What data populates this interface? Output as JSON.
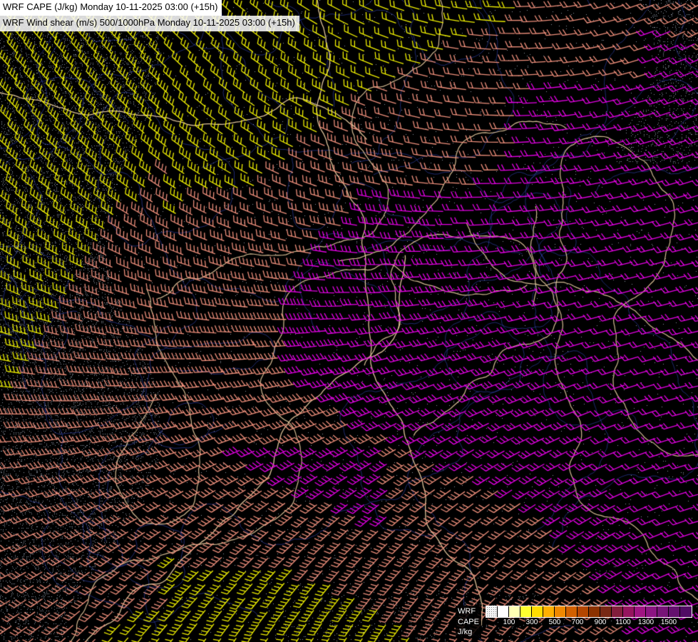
{
  "header": {
    "line1": "WRF CAPE (J/kg) Monday 10-11-2025 03:00 (+15h)",
    "line2": "WRF Wind shear (m/s) 500/1000hPa Monday 10-11-2025 03:00 (+15h)"
  },
  "legend": {
    "label_lines": [
      "WRF",
      "CAPE",
      "J/kg"
    ],
    "tick_values": [
      "100",
      "300",
      "500",
      "700",
      "900",
      "1100",
      "1300",
      "1500"
    ],
    "swatch_colors": [
      "stipple",
      "#ffffff",
      "#ffffb4",
      "#ffff30",
      "#ffdc00",
      "#ffb000",
      "#f08800",
      "#d26000",
      "#b44600",
      "#8c3200",
      "#782814",
      "#821e3c",
      "#96145f",
      "#a01482",
      "#8c1482",
      "#781478",
      "#64106e",
      "#500c64"
    ]
  },
  "map": {
    "background": "#000000",
    "barb_colors": {
      "yellow": "#f2f200",
      "salmon": "#f0907c",
      "magenta": "#e600e6"
    },
    "border_color": "#eccfa2",
    "river_color": "#3c50d2",
    "stipple_color": "rgba(165,175,190,0.85)"
  }
}
